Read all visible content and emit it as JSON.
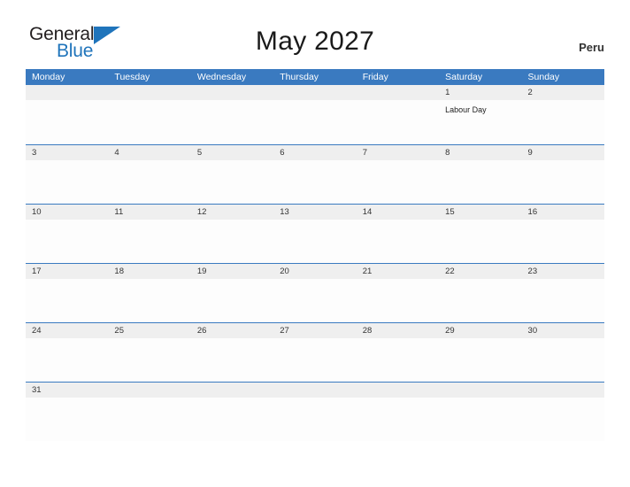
{
  "brand": {
    "name_part1": "General",
    "name_part2": "Blue",
    "triangle_color": "#1f74bb"
  },
  "header": {
    "title": "May 2027",
    "country": "Peru"
  },
  "theme": {
    "header_blue": "#3a7ac0",
    "number_band": "#efefef",
    "cell_bg": "#fdfdfd",
    "page_bg": "#ffffff"
  },
  "calendar": {
    "weekday_headers": [
      "Monday",
      "Tuesday",
      "Wednesday",
      "Thursday",
      "Friday",
      "Saturday",
      "Sunday"
    ],
    "weeks": [
      {
        "days": [
          {
            "number": "",
            "event": ""
          },
          {
            "number": "",
            "event": ""
          },
          {
            "number": "",
            "event": ""
          },
          {
            "number": "",
            "event": ""
          },
          {
            "number": "",
            "event": ""
          },
          {
            "number": "1",
            "event": "Labour Day"
          },
          {
            "number": "2",
            "event": ""
          }
        ]
      },
      {
        "days": [
          {
            "number": "3",
            "event": ""
          },
          {
            "number": "4",
            "event": ""
          },
          {
            "number": "5",
            "event": ""
          },
          {
            "number": "6",
            "event": ""
          },
          {
            "number": "7",
            "event": ""
          },
          {
            "number": "8",
            "event": ""
          },
          {
            "number": "9",
            "event": ""
          }
        ]
      },
      {
        "days": [
          {
            "number": "10",
            "event": ""
          },
          {
            "number": "11",
            "event": ""
          },
          {
            "number": "12",
            "event": ""
          },
          {
            "number": "13",
            "event": ""
          },
          {
            "number": "14",
            "event": ""
          },
          {
            "number": "15",
            "event": ""
          },
          {
            "number": "16",
            "event": ""
          }
        ]
      },
      {
        "days": [
          {
            "number": "17",
            "event": ""
          },
          {
            "number": "18",
            "event": ""
          },
          {
            "number": "19",
            "event": ""
          },
          {
            "number": "20",
            "event": ""
          },
          {
            "number": "21",
            "event": ""
          },
          {
            "number": "22",
            "event": ""
          },
          {
            "number": "23",
            "event": ""
          }
        ]
      },
      {
        "days": [
          {
            "number": "24",
            "event": ""
          },
          {
            "number": "25",
            "event": ""
          },
          {
            "number": "26",
            "event": ""
          },
          {
            "number": "27",
            "event": ""
          },
          {
            "number": "28",
            "event": ""
          },
          {
            "number": "29",
            "event": ""
          },
          {
            "number": "30",
            "event": ""
          }
        ]
      },
      {
        "days": [
          {
            "number": "31",
            "event": ""
          },
          {
            "number": "",
            "event": ""
          },
          {
            "number": "",
            "event": ""
          },
          {
            "number": "",
            "event": ""
          },
          {
            "number": "",
            "event": ""
          },
          {
            "number": "",
            "event": ""
          },
          {
            "number": "",
            "event": ""
          }
        ]
      }
    ]
  }
}
